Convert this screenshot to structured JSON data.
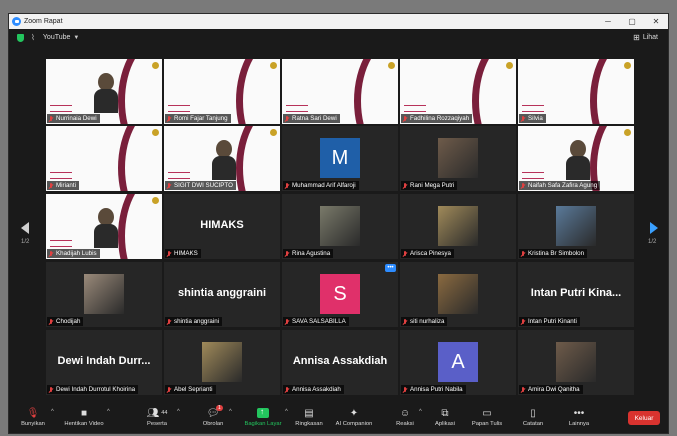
{
  "window": {
    "title": "Zoom Rapat"
  },
  "topbar": {
    "youtube_label": "YouTube",
    "view_label": "Lihat"
  },
  "pager": {
    "left": "1/2",
    "right": "1/2"
  },
  "participants": [
    {
      "name": "Nurrinaia Dewi",
      "kind": "slide-person"
    },
    {
      "name": "Romi Fajar Tanjung",
      "kind": "slide"
    },
    {
      "name": "Ratna Sari Dewi",
      "kind": "slide"
    },
    {
      "name": "Fadhilina Rozzaqiyah",
      "kind": "slide"
    },
    {
      "name": "Silvia",
      "kind": "slide"
    },
    {
      "name": "Mirianti",
      "kind": "slide"
    },
    {
      "name": "SIGIT DWI SUCIPTO",
      "kind": "slide-person",
      "active": true
    },
    {
      "name": "Muhammad Arif Alfaroji",
      "kind": "avatar",
      "initial": "M",
      "color": "#1f5fa8"
    },
    {
      "name": "Rani Mega Putri",
      "kind": "photo"
    },
    {
      "name": "Naifah Safa Zafira Agung",
      "kind": "slide-person"
    },
    {
      "name": "Khadijah Lubis",
      "kind": "slide-person"
    },
    {
      "name": "HIMAKS",
      "kind": "bigname",
      "display": "HIMAKS"
    },
    {
      "name": "Rina Agustina",
      "kind": "photo"
    },
    {
      "name": "Arisca Pinesya",
      "kind": "photo"
    },
    {
      "name": "Kristina Br Simbolon",
      "kind": "photo"
    },
    {
      "name": "Chodijah",
      "kind": "photo"
    },
    {
      "name": "shintia anggraini",
      "kind": "bigname",
      "display": "shintia anggraini"
    },
    {
      "name": "SAVA SALSABILLA",
      "kind": "avatar",
      "initial": "S",
      "color": "#e0306a"
    },
    {
      "name": "siti nurhaliza",
      "kind": "photo"
    },
    {
      "name": "Intan Putri Kinanti",
      "kind": "bigname",
      "display": "Intan Putri Kina..."
    },
    {
      "name": "Dewi Indah Durrotul Khoirina",
      "kind": "bigname",
      "display": "Dewi Indah Durr..."
    },
    {
      "name": "Abel Seprianti",
      "kind": "photo"
    },
    {
      "name": "Annisa Assakdiah",
      "kind": "bigname",
      "display": "Annisa Assakdiah"
    },
    {
      "name": "Annisa Putri Nabila",
      "kind": "avatar",
      "initial": "A",
      "color": "#5a5fc8"
    },
    {
      "name": "Amira Dwi Qanitha",
      "kind": "photo"
    }
  ],
  "toolbar": {
    "unmute": "Bunyikan",
    "stop_video": "Hentikan Video",
    "participants": "Peserta",
    "participants_count": "44",
    "chat": "Obrolan",
    "chat_badge": "1",
    "share": "Bagikan Layar",
    "summary": "Ringkasan",
    "companion": "AI Companion",
    "reactions": "Reaksi",
    "apps": "Aplikasi",
    "whiteboard": "Papan Tulis",
    "notes": "Catatan",
    "more": "Lainnya",
    "leave": "Keluar"
  }
}
